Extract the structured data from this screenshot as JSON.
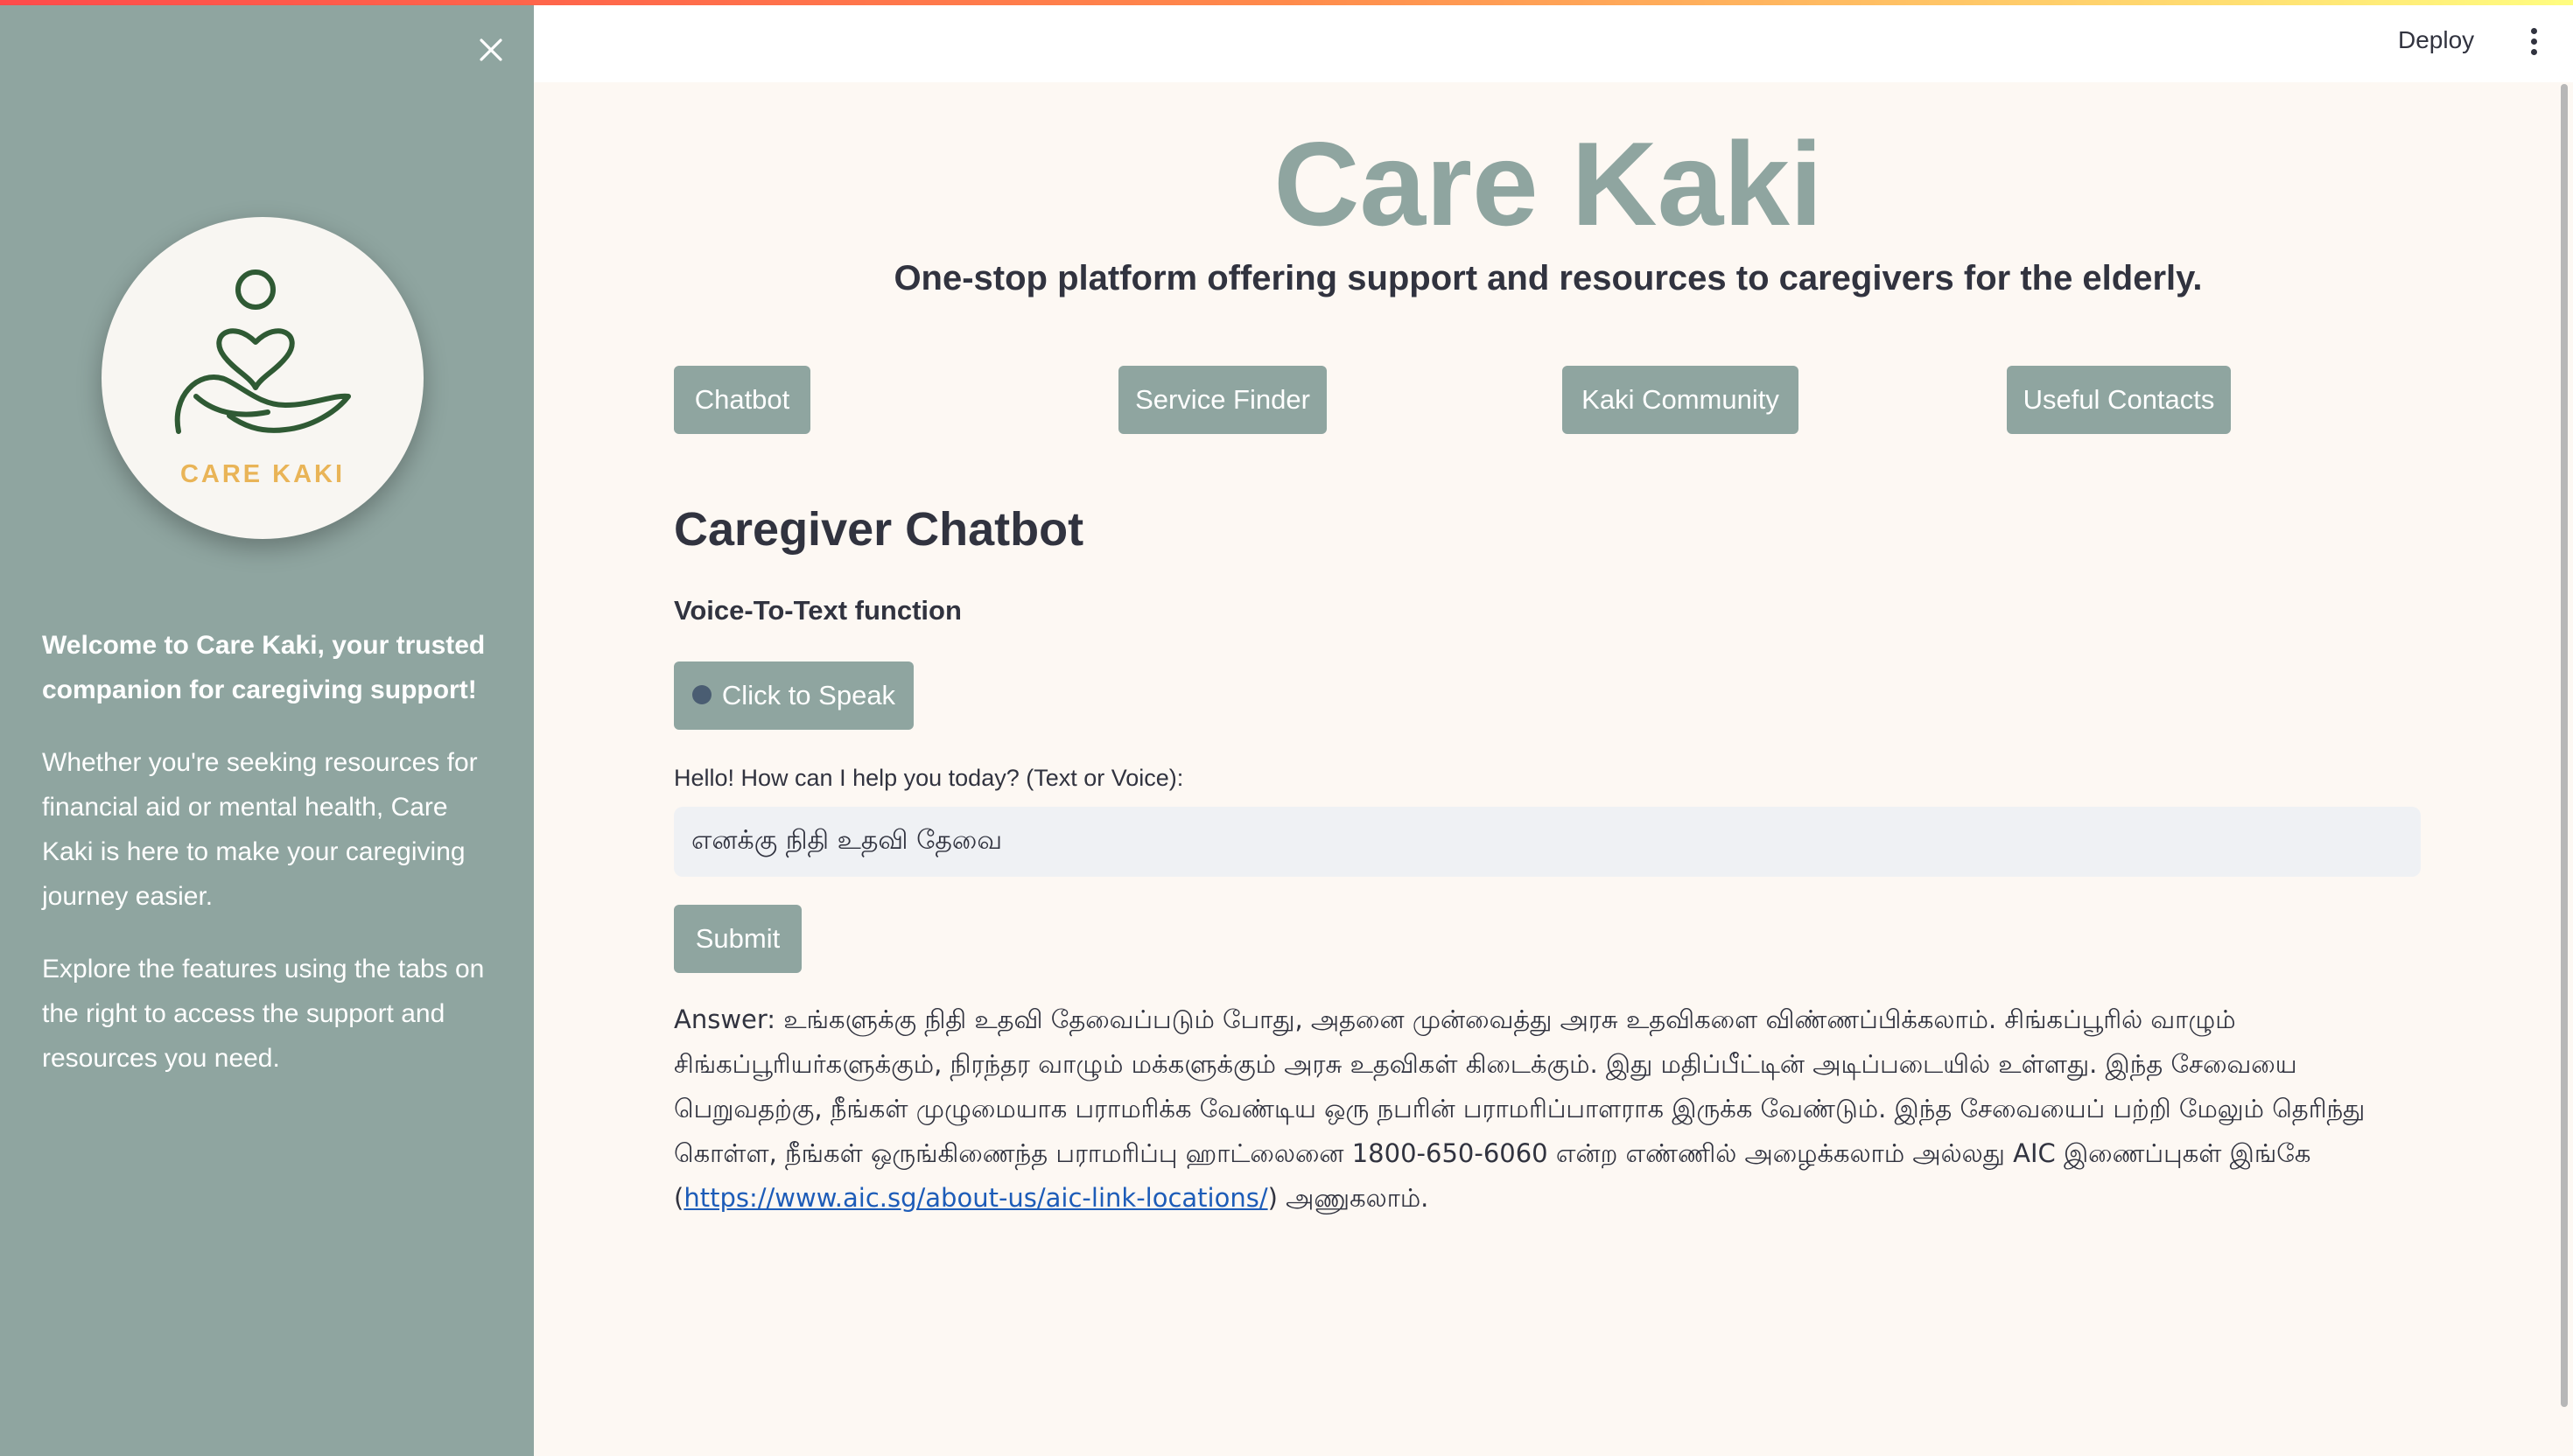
{
  "header": {
    "deploy_label": "Deploy",
    "menu_icon": "kebab-menu-icon"
  },
  "sidebar": {
    "close_icon": "close-icon",
    "logo_text": "CARE KAKI",
    "welcome": "Welcome to Care Kaki, your trusted companion for caregiving support!",
    "paragraph1": "Whether you're seeking resources for financial aid or mental health, Care Kaki is here to make your caregiving journey easier.",
    "paragraph2": "Explore the features using the tabs on the right to access the support and resources you need."
  },
  "main": {
    "title": "Care Kaki",
    "subtitle": "One-stop platform offering support and resources to caregivers for the elderly.",
    "tabs": [
      {
        "label": "Chatbot"
      },
      {
        "label": "Service Finder"
      },
      {
        "label": "Kaki Community"
      },
      {
        "label": "Useful Contacts"
      }
    ],
    "section_title": "Caregiver Chatbot",
    "voice_heading": "Voice-To-Text function",
    "speak_button": "Click to Speak",
    "input_label": "Hello! How can I help you today? (Text or Voice):",
    "input_value": "எனக்கு நிதி உதவி தேவை",
    "submit_label": "Submit",
    "answer_text": "Answer: உங்களுக்கு நிதி உதவி தேவைப்படும் போது, அதனை முன்வைத்து அரசு உதவிகளை விண்ணப்பிக்கலாம். சிங்கப்பூரில் வாழும் சிங்கப்பூரியர்களுக்கும், நிரந்தர வாழும் மக்களுக்கும் அரசு உதவிகள் கிடைக்கும். இது மதிப்பீட்டின் அடிப்படையில் உள்ளது. இந்த சேவையை பெறுவதற்கு, நீங்கள் முழுமையாக பராமரிக்க வேண்டிய ஒரு நபரின் பராமரிப்பாளராக இருக்க வேண்டும். இந்த சேவையைப் பற்றி மேலும் தெரிந்து கொள்ள, நீங்கள் ஒருங்கிணைந்த பராமரிப்பு ஹாட்லைனை 1800-650-6060 என்ற எண்ணில் அழைக்கலாம் அல்லது AIC இணைப்புகள் இங்கே (",
    "answer_link": "https://www.aic.sg/about-us/aic-link-locations/",
    "answer_tail": ") அணுகலாம்."
  },
  "colors": {
    "sidebar_bg": "#8fa5a0",
    "accent": "#8fa5a0",
    "page_bg": "#fdf8f3",
    "logo_text": "#e9b457",
    "logo_line": "#2f5a34"
  }
}
